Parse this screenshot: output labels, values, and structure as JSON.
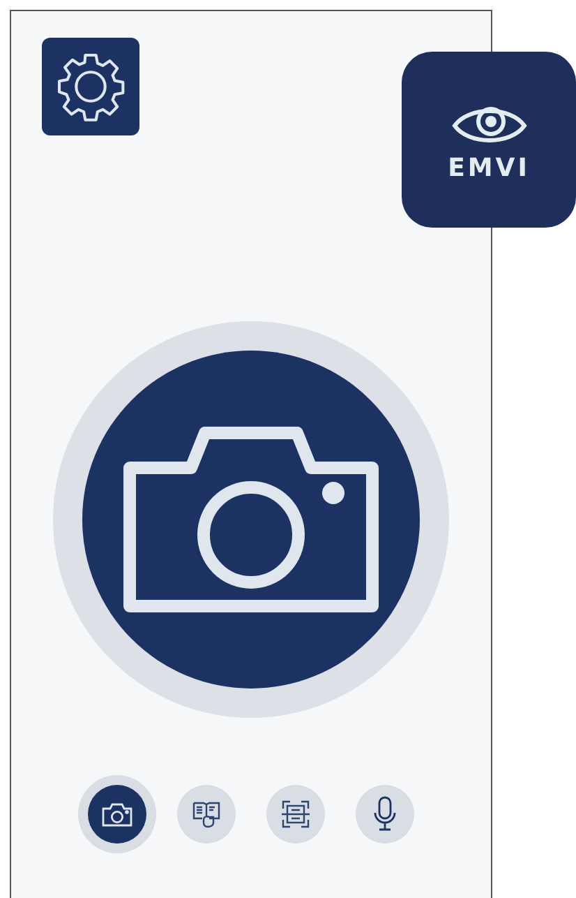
{
  "app_logo": {
    "text": "EMVI"
  },
  "modes": [
    {
      "kind": "camera",
      "selected": true
    },
    {
      "kind": "reader",
      "selected": false
    },
    {
      "kind": "scanner",
      "selected": false
    },
    {
      "kind": "microphone",
      "selected": false
    }
  ]
}
